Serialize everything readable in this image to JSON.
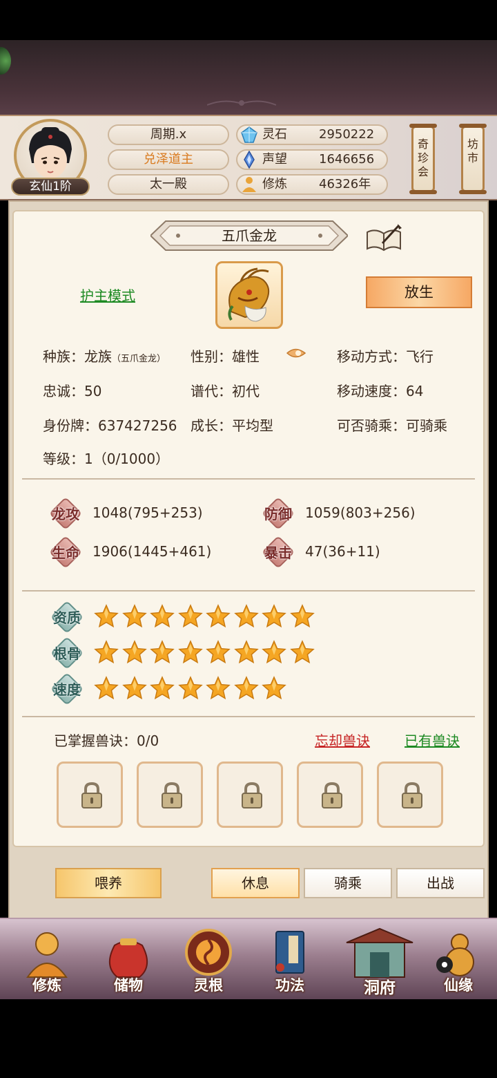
{
  "header": {
    "rank": "玄仙1阶",
    "pills": [
      "周期.x",
      "兑泽道主",
      "太一殿"
    ],
    "resources": [
      {
        "name": "灵石",
        "value": "2950222",
        "icon": "spirit-stone-icon"
      },
      {
        "name": "声望",
        "value": "1646656",
        "icon": "prestige-crystal-icon"
      },
      {
        "name": "修炼",
        "value": "46326年",
        "icon": "meditation-icon"
      }
    ],
    "scrolls": [
      "奇\n珍\n会",
      "坊\n市"
    ]
  },
  "pet": {
    "name": "五爪金龙",
    "mode_link": "护主模式",
    "release_button": "放生",
    "info": {
      "race_label": "种族：龙族",
      "race_sub": "（五爪金龙）",
      "gender": "性别：雄性",
      "move_type": "移动方式：飞行",
      "loyalty": "忠诚：50",
      "generation": "谱代：初代",
      "move_speed": "移动速度：64",
      "id_tag": "身份牌：637427256",
      "growth": "成长：平均型",
      "rideable": "可否骑乘：可骑乘",
      "level": "等级：1（0/1000）"
    },
    "stats": [
      {
        "label": "龙攻",
        "value": "1048(795+253)"
      },
      {
        "label": "防御",
        "value": "1059(803+256)"
      },
      {
        "label": "生命",
        "value": "1906(1445+461)"
      },
      {
        "label": "暴击",
        "value": "47(36+11)"
      }
    ],
    "ratings": [
      {
        "label": "资质",
        "stars": 8
      },
      {
        "label": "根骨",
        "stars": 8
      },
      {
        "label": "速度",
        "stars": 7
      }
    ],
    "skills": {
      "mastered": "已掌握兽诀：0/0",
      "forget_link": "忘却兽诀",
      "owned_link": "已有兽诀",
      "locked_slots": 5
    }
  },
  "actions": {
    "feed": "喂养",
    "rest": "休息",
    "ride": "骑乘",
    "battle": "出战"
  },
  "nav": [
    "修炼",
    "储物",
    "灵根",
    "功法",
    "洞府",
    "仙缘"
  ],
  "colors": {
    "accent_orange": "#f6a864",
    "link_green": "#1d8a23",
    "link_red": "#c62424",
    "star": "#f5a623"
  }
}
